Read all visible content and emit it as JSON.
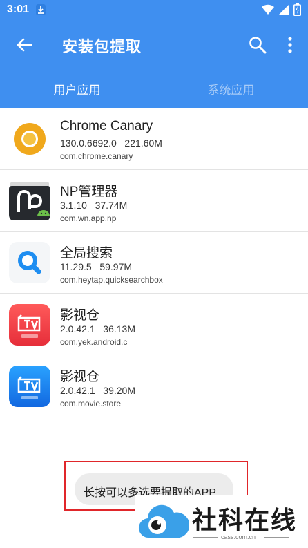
{
  "status": {
    "time": "3:01"
  },
  "appbar": {
    "title": "安装包提取"
  },
  "tabs": [
    {
      "label": "用户应用",
      "active": true
    },
    {
      "label": "系统应用",
      "active": false
    }
  ],
  "apps": [
    {
      "name": "Chrome Canary",
      "version": "130.0.6692.0",
      "size": "221.60M",
      "package": "com.chrome.canary",
      "icon": "chrome-canary-icon"
    },
    {
      "name": "NP管理器",
      "version": "3.1.10",
      "size": "37.74M",
      "package": "com.wn.app.np",
      "icon": "np-manager-icon"
    },
    {
      "name": "全局搜索",
      "version": "11.29.5",
      "size": "59.97M",
      "package": "com.heytap.quicksearchbox",
      "icon": "global-search-icon"
    },
    {
      "name": "影视仓",
      "version": "2.0.42.1",
      "size": "36.13M",
      "package": "com.yek.android.c",
      "icon": "tv-warehouse-red-icon"
    },
    {
      "name": "影视仓",
      "version": "2.0.42.1",
      "size": "39.20M",
      "package": "com.movie.store",
      "icon": "tv-warehouse-blue-icon"
    }
  ],
  "toast": {
    "text": "长按可以多选要提取的APP"
  },
  "watermark": {
    "name": "社科在线",
    "url": "cass.com.cn"
  },
  "colors": {
    "primary": "#3f8ff0",
    "tab_inactive": "#a9ccf7",
    "toast_frame": "#e0262a"
  }
}
